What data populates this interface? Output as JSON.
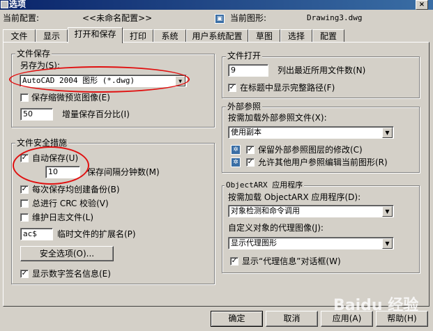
{
  "window": {
    "title": "选项",
    "close": "×"
  },
  "header": {
    "current_profile_label": "当前配置:",
    "current_profile_value": "<<未命名配置>>",
    "current_drawing_label": "当前图形:",
    "current_drawing_value": "Drawing3.dwg"
  },
  "tabs": [
    "文件",
    "显示",
    "打开和保存",
    "打印",
    "系统",
    "用户系统配置",
    "草图",
    "选择",
    "配置"
  ],
  "active_tab": "打开和保存",
  "file_save": {
    "group_title": "文件保存",
    "save_as_label": "另存为(S):",
    "save_as_value": "AutoCAD 2004 图形 (*.dwg)",
    "thumbnail_label": "保存缩微预览图像(E)",
    "thumbnail_checked": false,
    "incremental_value": "50",
    "incremental_label": "增量保存百分比(I)"
  },
  "file_safety": {
    "group_title": "文件安全措施",
    "autosave_label": "自动保存(U)",
    "autosave_checked": true,
    "interval_value": "10",
    "interval_label": "保存间隔分钟数(M)",
    "backup_label": "每次保存均创建备份(B)",
    "backup_checked": true,
    "crc_label": "总进行 CRC 校验(V)",
    "crc_checked": false,
    "log_label": "维护日志文件(L)",
    "log_checked": false,
    "ext_value": "ac$",
    "ext_label": "临时文件的扩展名(P)",
    "security_button": "安全选项(O)...",
    "signature_label": "显示数字签名信息(E)",
    "signature_checked": true
  },
  "file_open": {
    "group_title": "文件打开",
    "recent_value": "9",
    "recent_label": "列出最近所用文件数(N)",
    "fullpath_label": "在标题中显示完整路径(F)",
    "fullpath_checked": true
  },
  "xref": {
    "group_title": "外部参照",
    "demand_label": "按需加载外部参照文件(X):",
    "demand_value": "使用副本",
    "retain_label": "保留外部参照图层的修改(C)",
    "retain_checked": true,
    "allow_label": "允许其他用户参照编辑当前图形(R)",
    "allow_checked": true
  },
  "objectarx": {
    "group_title": "ObjectARX 应用程序",
    "demand_label": "按需加载 ObjectARX 应用程序(D):",
    "demand_value": "对象检测和命令调用",
    "proxy_label": "自定义对象的代理图像(J):",
    "proxy_value": "显示代理图形",
    "proxyinfo_label": "显示“代理信息”对话框(W)",
    "proxyinfo_checked": true
  },
  "footer": {
    "ok": "确定",
    "cancel": "取消",
    "apply": "应用(A)",
    "help": "帮助(H)"
  },
  "watermark": "Baidu 经验",
  "check_glyph": "✓",
  "dropdown_glyph": "▼"
}
